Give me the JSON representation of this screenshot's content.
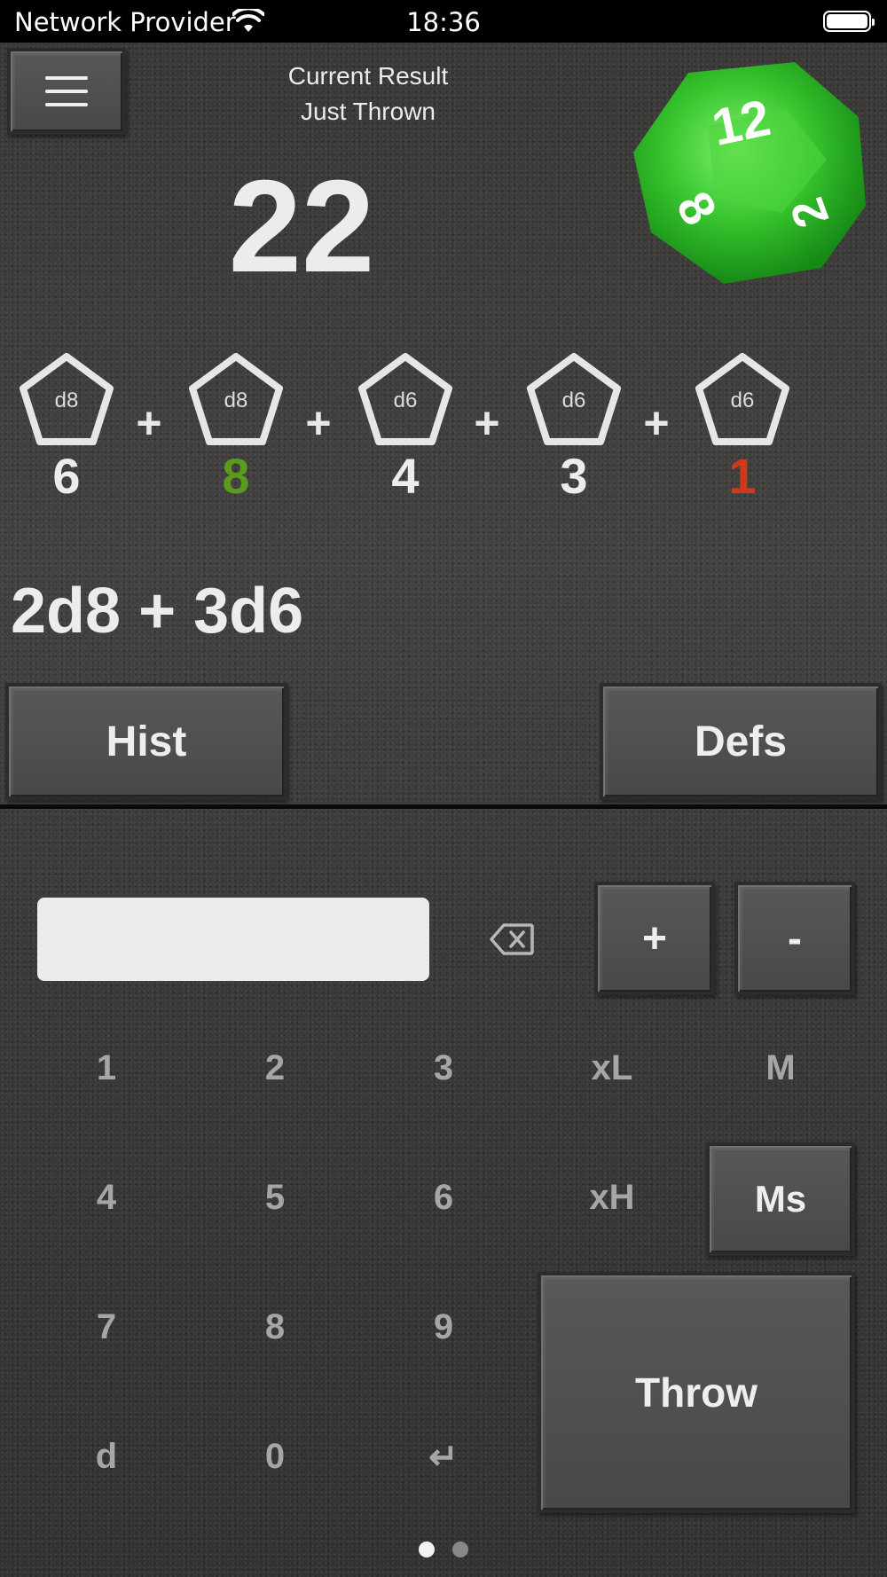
{
  "status_bar": {
    "carrier": "Network Provider",
    "time": "18:36"
  },
  "header": {
    "current_label_line1": "Current Result",
    "current_label_line2": "Just Thrown",
    "result": "22",
    "die_face_numbers": [
      "12",
      "8",
      "2"
    ]
  },
  "dice": [
    {
      "type": "d8",
      "value": "6",
      "color": "#ececec"
    },
    {
      "type": "d8",
      "value": "8",
      "color": "#5a9a1c"
    },
    {
      "type": "d6",
      "value": "4",
      "color": "#ececec"
    },
    {
      "type": "d6",
      "value": "3",
      "color": "#ececec"
    },
    {
      "type": "d6",
      "value": "1",
      "color": "#d2391a"
    }
  ],
  "plus_sign": "+",
  "expression": "2d8 + 3d6",
  "buttons": {
    "hist": "Hist",
    "defs": "Defs",
    "plus": "+",
    "minus": "-",
    "ms": "Ms",
    "throw": "Throw"
  },
  "entry": {
    "value": ""
  },
  "keypad": {
    "row1": [
      "1",
      "2",
      "3",
      "xL",
      "M"
    ],
    "row2": [
      "4",
      "5",
      "6",
      "xH"
    ],
    "row3": [
      "7",
      "8",
      "9"
    ],
    "row4": [
      "d",
      "0",
      "↵"
    ]
  },
  "icons": {
    "menu": "hamburger-icon",
    "backspace": "backspace-icon",
    "wifi": "wifi-icon",
    "battery": "battery-icon"
  },
  "pager": {
    "current": 1,
    "total": 2
  },
  "colors": {
    "high_roll": "#5a9a1c",
    "low_roll": "#d2391a",
    "die_green": "#2fb52a"
  }
}
